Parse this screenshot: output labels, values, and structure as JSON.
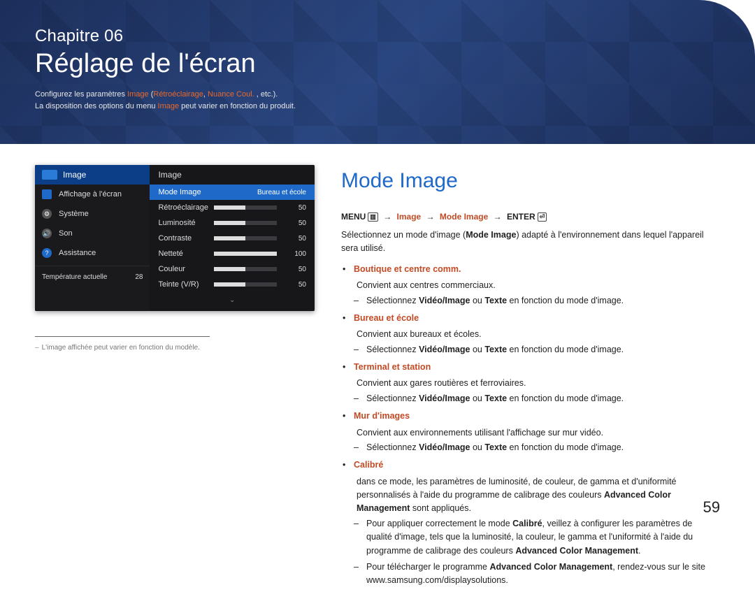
{
  "header": {
    "chapter_label": "Chapitre 06",
    "title": "Réglage de l'écran",
    "intro_pre": "Configurez les paramètres ",
    "intro_red1": "Image",
    "intro_mid1": " (",
    "intro_red2": "Rétroéclairage",
    "intro_mid2": ", ",
    "intro_red3": "Nuance Coul.",
    "intro_post1": " , etc.).",
    "intro_line2_pre": "La disposition des options du menu ",
    "intro_line2_red": "Image",
    "intro_line2_post": " peut varier en fonction du produit."
  },
  "menu": {
    "side_head": "Image",
    "items": [
      {
        "label": "Affichage à l'écran",
        "bg": "#1f69c9",
        "shape": "sq"
      },
      {
        "label": "Système",
        "bg": "#555",
        "shape": "gear",
        "glyph": "⚙"
      },
      {
        "label": "Son",
        "bg": "#555",
        "shape": "round",
        "glyph": "🔊"
      },
      {
        "label": "Assistance",
        "bg": "#1f69c9",
        "shape": "round",
        "glyph": "?"
      }
    ],
    "temp_label": "Température actuelle",
    "temp_value": "28",
    "panel_head": "Image",
    "rows": [
      {
        "label": "Mode Image",
        "value": "Bureau et école",
        "selected": true,
        "bar": false
      },
      {
        "label": "Rétroéclairage",
        "value": "50",
        "bar": true,
        "pct": 50
      },
      {
        "label": "Luminosité",
        "value": "50",
        "bar": true,
        "pct": 50
      },
      {
        "label": "Contraste",
        "value": "50",
        "bar": true,
        "pct": 50
      },
      {
        "label": "Netteté",
        "value": "100",
        "bar": true,
        "pct": 100
      },
      {
        "label": "Couleur",
        "value": "50",
        "bar": true,
        "pct": 50
      },
      {
        "label": "Teinte (V/R)",
        "value": "50",
        "bar": true,
        "pct": 50
      }
    ],
    "more_glyph": "⌄"
  },
  "footnote": "L'image affichée peut varier en fonction du modèle.",
  "section": {
    "title": "Mode Image",
    "crumbs": {
      "menu": "MENU",
      "menu_icon": "▥",
      "arrow": "→",
      "p1": "Image",
      "p2": "Mode Image",
      "enter": "ENTER",
      "enter_icon": "⏎"
    },
    "desc_pre": "Sélectionnez un mode d'image (",
    "desc_bold": "Mode Image",
    "desc_post": ") adapté à l'environnement dans lequel l'appareil sera utilisé.",
    "common_select_pre": "Sélectionnez ",
    "common_select_b1": "Vidéo/Image",
    "common_select_mid": " ou ",
    "common_select_b2": "Texte",
    "common_select_post": " en fonction du mode d'image.",
    "modes": [
      {
        "name": "Boutique et centre comm.",
        "text": "Convient aux centres commerciaux.",
        "sel": true
      },
      {
        "name": "Bureau et école",
        "text": "Convient aux bureaux et écoles.",
        "sel": true
      },
      {
        "name": "Terminal et station",
        "text": "Convient aux gares routières et ferroviaires.",
        "sel": true
      },
      {
        "name": "Mur d'images",
        "text": "Convient aux environnements utilisant l'affichage sur mur vidéo.",
        "sel": true
      },
      {
        "name": "Calibré",
        "text": "dans ce mode, les paramètres de luminosité, de couleur, de gamma et d'uniformité personnalisés à l'aide du programme de calibrage des couleurs ",
        "bold_tail": "Advanced Color Management",
        "text_tail": " sont appliqués.",
        "calibre": true
      }
    ],
    "calibre_sub1_pre": "Pour appliquer correctement le mode ",
    "calibre_sub1_b1": "Calibré",
    "calibre_sub1_mid": ", veillez à configurer les paramètres de qualité d'image, tels que la luminosité, la couleur, le gamma et l'uniformité à l'aide du programme de calibrage des couleurs ",
    "calibre_sub1_b2": "Advanced Color Management",
    "calibre_sub1_post": ".",
    "calibre_sub2_pre": "Pour télécharger le programme ",
    "calibre_sub2_b": "Advanced Color Management",
    "calibre_sub2_post": ", rendez-vous sur le site www.samsung.com/displaysolutions."
  },
  "page_number": "59"
}
